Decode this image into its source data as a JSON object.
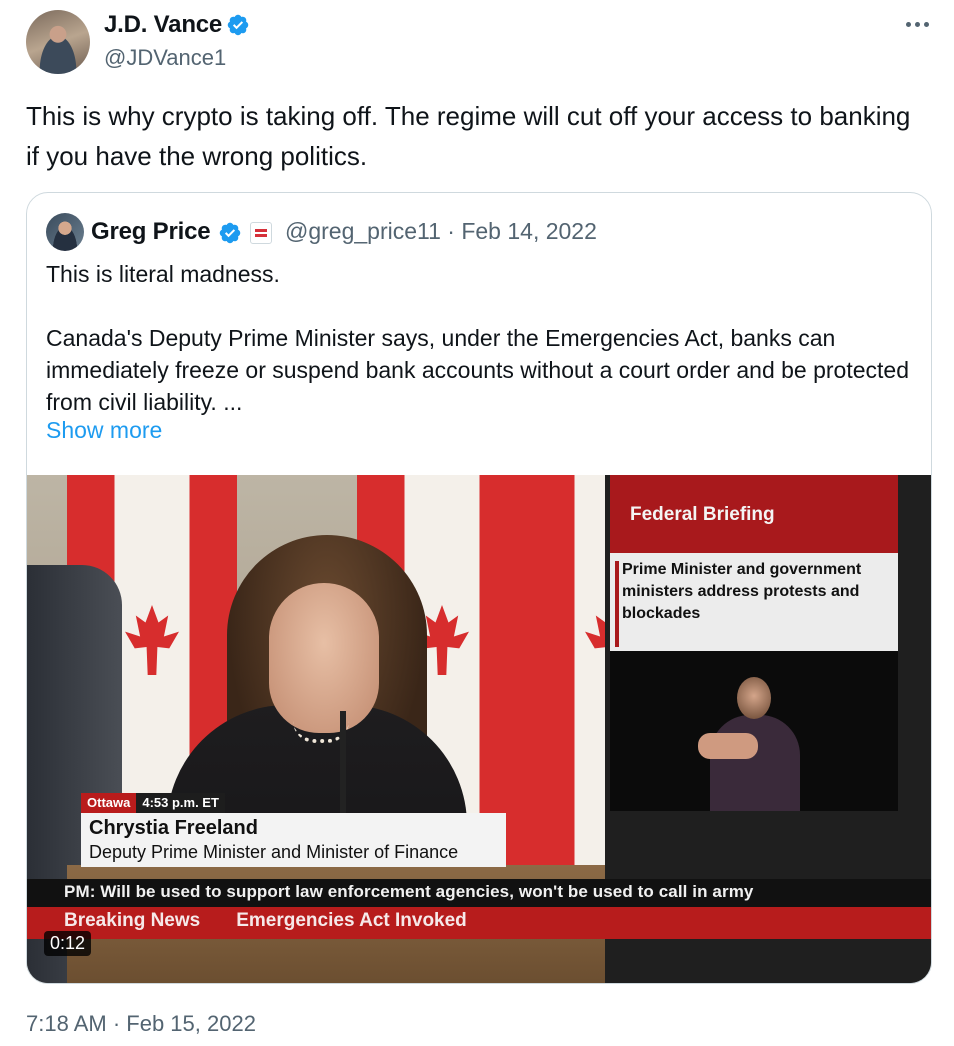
{
  "author": {
    "name": "J.D. Vance",
    "handle": "@JDVance1",
    "verified": true,
    "avatar_icon": "profile-photo"
  },
  "tweet": {
    "text": "This is why crypto is taking off. The regime will cut off your access to banking if you have the wrong politics.",
    "timestamp": "7:18 AM · Feb 15, 2022"
  },
  "quoted": {
    "author_name": "Greg Price",
    "verified": true,
    "affiliation_badge": "affiliation-badge",
    "meta": "@greg_price11 · Feb 14, 2022",
    "paragraph_1": "This is literal madness.",
    "paragraph_2": "Canada's Deputy Prime Minister says, under the Emergencies Act, banks can immediately freeze or suspend bank accounts without a court order and be protected from civil liability. ...",
    "show_more": "Show more"
  },
  "video": {
    "location": "Ottawa",
    "time": "4:53 p.m. ET",
    "speaker_name": "Chrystia Freeland",
    "speaker_title": "Deputy Prime Minister and Minister of Finance",
    "panel_header": "Federal Briefing",
    "panel_text": "Prime Minister and government ministers address protests and blockades",
    "ticker": "PM: Will be used to support law enforcement agencies, won't be used to call in army",
    "breaking_label": "Breaking News",
    "breaking_text": "Emergencies Act Invoked",
    "duration": "0:12"
  },
  "colors": {
    "verified_blue": "#1d9bf0",
    "link_blue": "#1d9bf0",
    "secondary_text": "#536471",
    "news_red": "#b71c1c"
  }
}
